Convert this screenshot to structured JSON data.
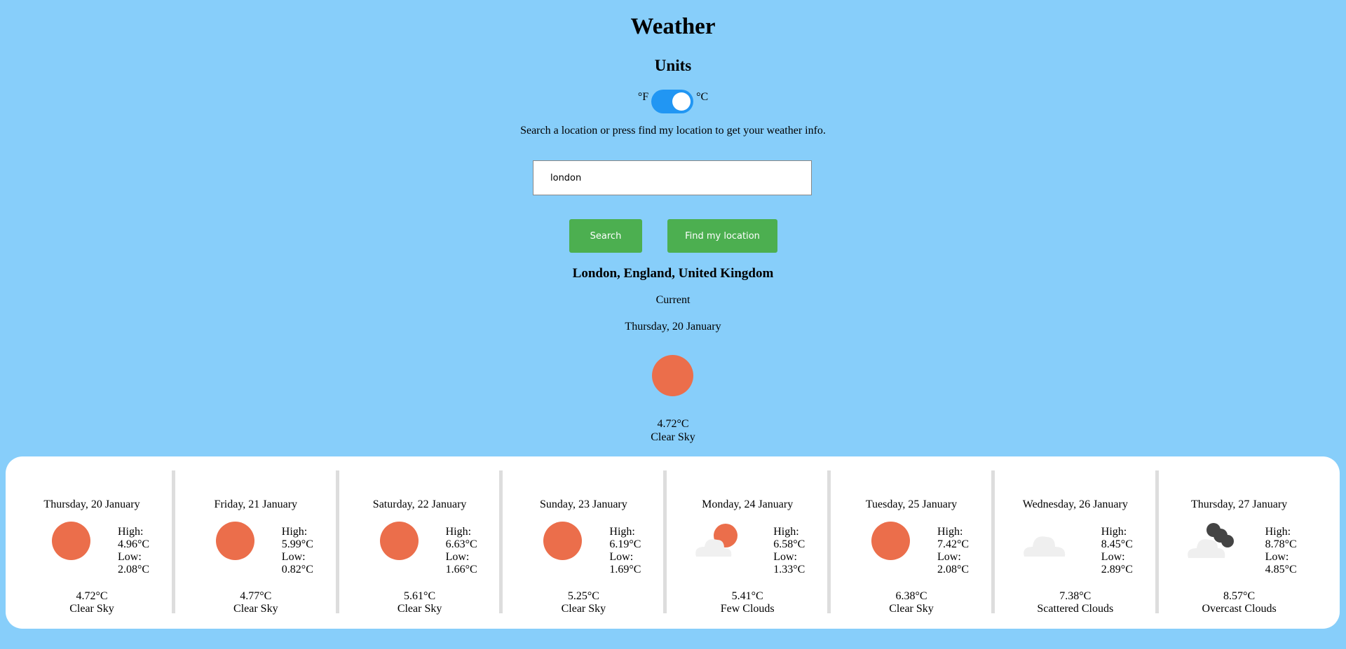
{
  "header": {
    "title": "Weather",
    "units_heading": "Units",
    "unit_f": "°F",
    "unit_c": "°C"
  },
  "units_toggle": {
    "selected": "°C"
  },
  "hint": "Search a location or press find my location to get your weather info.",
  "search": {
    "value": "london",
    "button": "Search",
    "locate_button": "Find my location"
  },
  "location": "London, England, United Kingdom",
  "current": {
    "label": "Current",
    "date": "Thursday, 20 January",
    "temp": "4.72°C",
    "desc": "Clear Sky",
    "icon": "sun-icon"
  },
  "colors": {
    "background": "#87cefa",
    "accent": "#2196f3",
    "button": "#4caf50",
    "sun": "#eb6e4b"
  },
  "forecast": [
    {
      "date": "Thursday, 20 January",
      "high_label": "High:",
      "high": "4.96°C",
      "low_label": "Low:",
      "low": "2.08°C",
      "temp": "4.72°C",
      "desc": "Clear Sky",
      "icon": "sun-icon"
    },
    {
      "date": "Friday, 21 January",
      "high_label": "High:",
      "high": "5.99°C",
      "low_label": "Low:",
      "low": "0.82°C",
      "temp": "4.77°C",
      "desc": "Clear Sky",
      "icon": "sun-icon"
    },
    {
      "date": "Saturday, 22 January",
      "high_label": "High:",
      "high": "6.63°C",
      "low_label": "Low:",
      "low": "1.66°C",
      "temp": "5.61°C",
      "desc": "Clear Sky",
      "icon": "sun-icon"
    },
    {
      "date": "Sunday, 23 January",
      "high_label": "High:",
      "high": "6.19°C",
      "low_label": "Low:",
      "low": "1.69°C",
      "temp": "5.25°C",
      "desc": "Clear Sky",
      "icon": "sun-icon"
    },
    {
      "date": "Monday, 24 January",
      "high_label": "High:",
      "high": "6.58°C",
      "low_label": "Low:",
      "low": "1.33°C",
      "temp": "5.41°C",
      "desc": "Few Clouds",
      "icon": "sun-cloud-icon"
    },
    {
      "date": "Tuesday, 25 January",
      "high_label": "High:",
      "high": "7.42°C",
      "low_label": "Low:",
      "low": "2.08°C",
      "temp": "6.38°C",
      "desc": "Clear Sky",
      "icon": "sun-icon"
    },
    {
      "date": "Wednesday, 26 January",
      "high_label": "High:",
      "high": "8.45°C",
      "low_label": "Low:",
      "low": "2.89°C",
      "temp": "7.38°C",
      "desc": "Scattered Clouds",
      "icon": "cloud-icon"
    },
    {
      "date": "Thursday, 27 January",
      "high_label": "High:",
      "high": "8.78°C",
      "low_label": "Low:",
      "low": "4.85°C",
      "temp": "8.57°C",
      "desc": "Overcast Clouds",
      "icon": "overcast-cloud-icon"
    }
  ]
}
